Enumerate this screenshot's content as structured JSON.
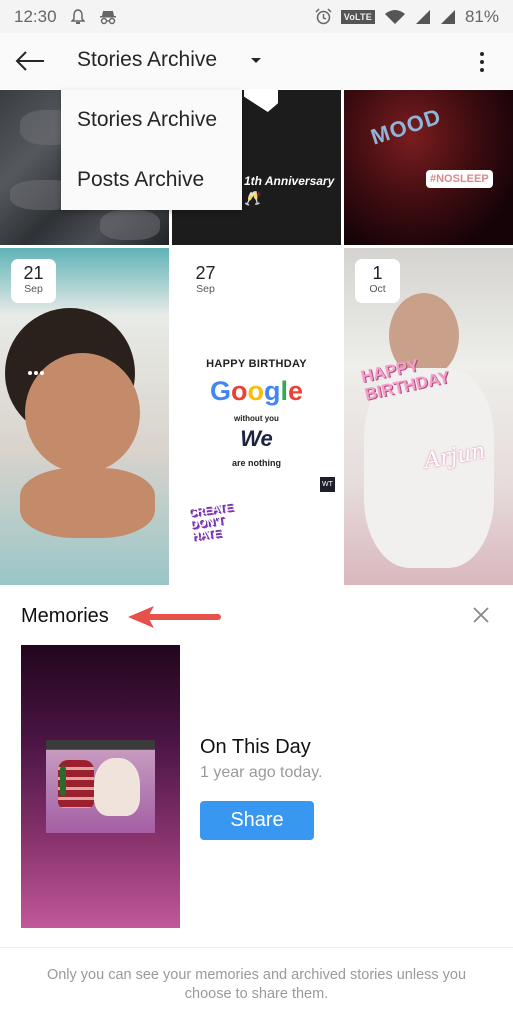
{
  "status_bar": {
    "time": "12:30",
    "left_icons": [
      "notification-bell-icon",
      "incognito-icon"
    ],
    "right_icons": [
      "alarm-icon",
      "volte-badge",
      "wifi-icon",
      "signal-icon-1",
      "signal-icon-2"
    ],
    "volte_label": "VoLTE",
    "battery": "81%"
  },
  "app_bar": {
    "back_icon": "arrow-left-icon",
    "title": "Stories Archive",
    "dropdown_icon": "caret-down-icon",
    "more_icon": "more-vertical-icon"
  },
  "dropdown_menu": {
    "items": [
      {
        "label": "Stories Archive"
      },
      {
        "label": "Posts Archive"
      }
    ]
  },
  "stories": [
    {
      "kind": "photo",
      "description": "person in camo shirt"
    },
    {
      "kind": "graphic",
      "caption": "1th Anniversary"
    },
    {
      "kind": "graphic",
      "caption": "MOOD",
      "tag": "#NOSLEEP"
    },
    {
      "kind": "photo",
      "day": "21",
      "month": "Sep",
      "description": "baby in stroller"
    },
    {
      "kind": "graphic",
      "day": "27",
      "month": "Sep",
      "lines": [
        "HAPPY BIRTHDAY",
        "Google",
        "without you",
        "We",
        "are nothing"
      ],
      "sticker": "CREATE DON'T HATE",
      "logo": "WT"
    },
    {
      "kind": "photo",
      "day": "1",
      "month": "Oct",
      "sticker": "HAPPY BIRTHDAY",
      "signature": "Arjun"
    }
  ],
  "memories": {
    "title": "Memories",
    "close_icon": "close-icon",
    "card": {
      "heading": "On This Day",
      "subtitle": "1 year ago today.",
      "share_label": "Share"
    }
  },
  "footer": {
    "text": "Only you can see your memories and archived stories unless you choose to share them."
  },
  "colors": {
    "accent": "#3897f0",
    "annotation_arrow": "#e8504a",
    "text_primary": "#262626",
    "text_secondary": "#9a9a9a"
  }
}
